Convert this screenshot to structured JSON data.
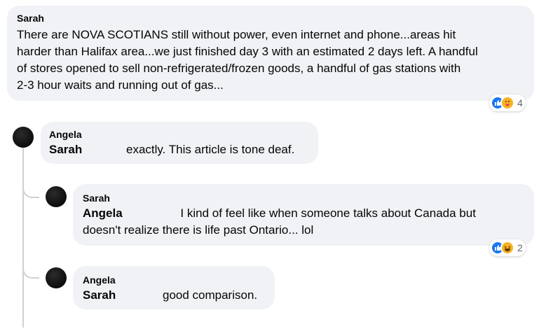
{
  "comments": [
    {
      "author": "Sarah",
      "lines": [
        "There are NOVA SCOTIANS still without power, even internet and phone...areas hit",
        "harder than Halifax area...we just finished day 3 with an estimated 2 days left. A handful",
        "of stores opened to sell non-refrigerated/frozen goods, a handful of gas stations with",
        "2-3 hour waits and running out of gas..."
      ],
      "reaction_count": "4"
    },
    {
      "author": "Angela",
      "mention": "Sarah",
      "text": "exactly. This article is tone deaf."
    },
    {
      "author": "Sarah",
      "mention": "Angela",
      "line1": "I kind of feel like when someone talks about Canada but",
      "line2": "doesn't realize there is life past Ontario... lol",
      "reaction_count": "2"
    },
    {
      "author": "Angela",
      "mention": "Sarah",
      "text": "good comparison."
    }
  ],
  "icons": {
    "like": "thumbs-up-icon",
    "care": "care-icon",
    "haha": "haha-icon"
  },
  "colors": {
    "bubble": "#f0f2f5",
    "like": "#1877f2",
    "emoji": "#f7b125",
    "thread_line": "#ced0d4"
  }
}
